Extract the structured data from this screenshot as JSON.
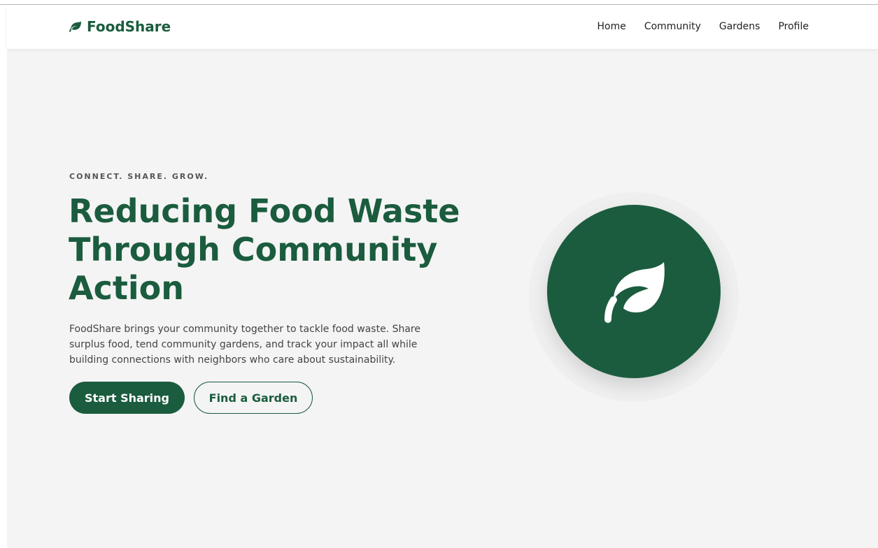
{
  "brand": {
    "name": "FoodShare",
    "icon": "leaf-icon",
    "color": "#1b5c3e"
  },
  "nav": {
    "items": [
      {
        "label": "Home"
      },
      {
        "label": "Community"
      },
      {
        "label": "Gardens"
      },
      {
        "label": "Profile"
      }
    ]
  },
  "hero": {
    "eyebrow": "CONNECT. SHARE. GROW.",
    "headline": "Reducing Food Waste Through Community Action",
    "description": "FoodShare brings your community together to tackle food waste. Share surplus food, tend community gardens, and track your impact all while building connections with neighbors who care about sustainability.",
    "primary_button": "Start Sharing",
    "secondary_button": "Find a Garden",
    "illustration_icon": "leaf-icon"
  },
  "colors": {
    "accent": "#1b5c3e",
    "background": "#f4f4f4"
  }
}
